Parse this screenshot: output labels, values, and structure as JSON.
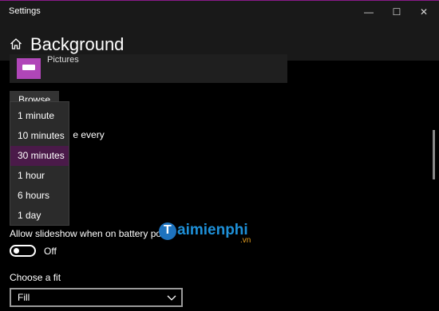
{
  "window": {
    "title": "Settings",
    "controls": {
      "minimize": "—",
      "maximize": "☐",
      "close": "✕"
    }
  },
  "header": {
    "title": "Background"
  },
  "picture": {
    "label": "Pictures"
  },
  "browse": {
    "label": "Browse"
  },
  "change_every": {
    "label_visible_part": "e every"
  },
  "interval_dropdown": {
    "options": [
      "1 minute",
      "10 minutes",
      "30 minutes",
      "1 hour",
      "6 hours",
      "1 day"
    ],
    "selected": "30 minutes"
  },
  "battery": {
    "label": "Allow slideshow when on battery po",
    "toggle_state": "Off"
  },
  "fit": {
    "label": "Choose a fit",
    "value": "Fill"
  },
  "watermark": {
    "brand": "aimienphi",
    "domain": ".vn"
  },
  "colors": {
    "accent_selection": "#4a1a49",
    "title_border": "#8a1a8a",
    "thumbnail": "#b046b8"
  }
}
